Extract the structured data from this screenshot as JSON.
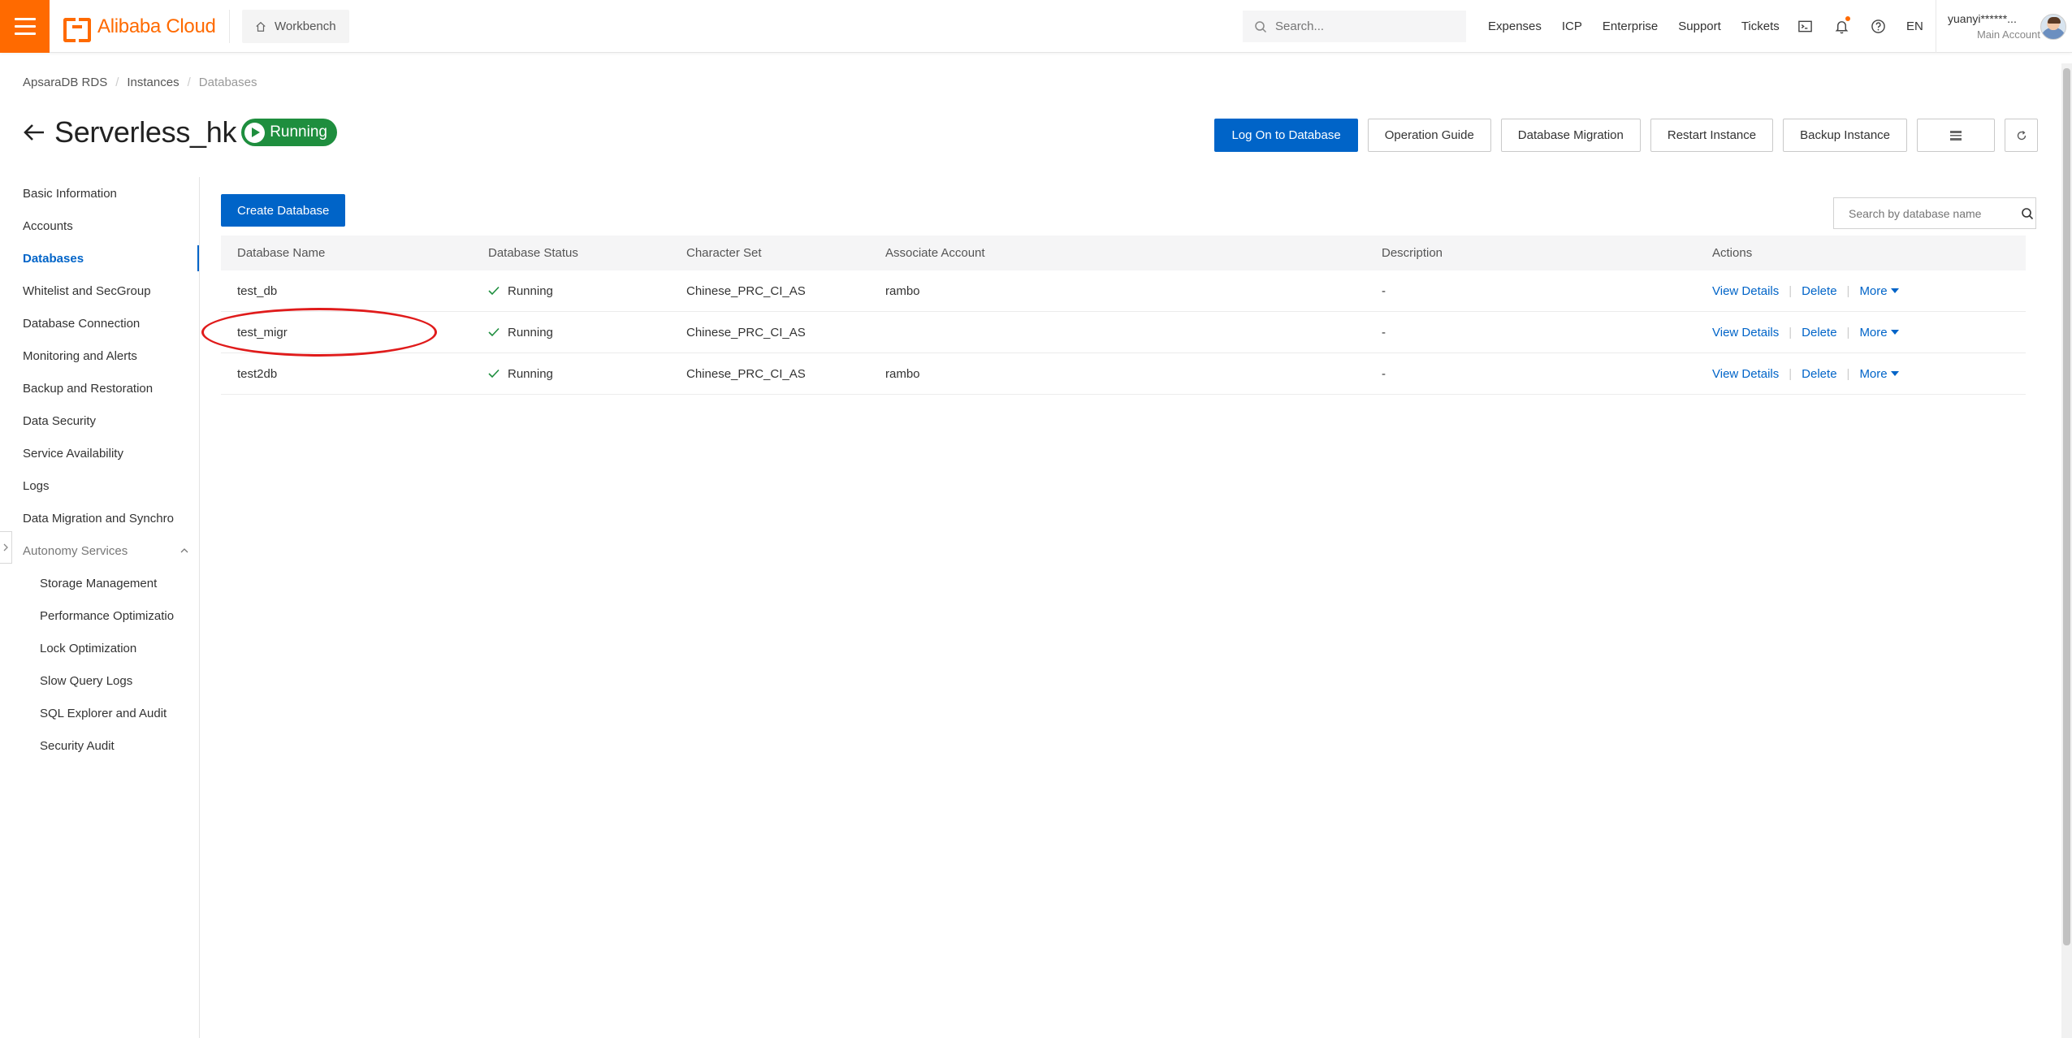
{
  "header": {
    "logo_text": "Alibaba Cloud",
    "workbench_label": "Workbench",
    "search_placeholder": "Search...",
    "links": [
      "Expenses",
      "ICP",
      "Enterprise",
      "Support",
      "Tickets"
    ],
    "language": "EN",
    "username": "yuanyi******...",
    "account_type": "Main Account",
    "brand_color": "#ff6a00"
  },
  "breadcrumb": [
    "ApsaraDB RDS",
    "Instances",
    "Databases"
  ],
  "instance": {
    "name": "Serverless_hk",
    "status": "Running"
  },
  "header_buttons": {
    "log_on": "Log On to Database",
    "operation_guide": "Operation Guide",
    "database_migration": "Database Migration",
    "restart_instance": "Restart Instance",
    "backup_instance": "Backup Instance"
  },
  "sidebar": {
    "items": [
      {
        "label": "Basic Information"
      },
      {
        "label": "Accounts"
      },
      {
        "label": "Databases",
        "active": true
      },
      {
        "label": "Whitelist and SecGroup"
      },
      {
        "label": "Database Connection"
      },
      {
        "label": "Monitoring and Alerts"
      },
      {
        "label": "Backup and Restoration"
      },
      {
        "label": "Data Security"
      },
      {
        "label": "Service Availability"
      },
      {
        "label": "Logs"
      },
      {
        "label": "Data Migration and Synchro"
      },
      {
        "label": "Autonomy Services"
      },
      {
        "label": "Storage Management"
      },
      {
        "label": "Performance Optimizatio"
      },
      {
        "label": "Lock Optimization"
      },
      {
        "label": "Slow Query Logs"
      },
      {
        "label": "SQL Explorer and Audit"
      },
      {
        "label": "Security Audit"
      }
    ]
  },
  "main": {
    "create_label": "Create Database",
    "search_placeholder": "Search by database name",
    "columns": [
      "Database Name",
      "Database Status",
      "Character Set",
      "Associate Account",
      "Description",
      "Actions"
    ],
    "rows": [
      {
        "name": "test_db",
        "status": "Running",
        "charset": "Chinese_PRC_CI_AS",
        "account": "rambo",
        "description": "-"
      },
      {
        "name": "test_migr",
        "status": "Running",
        "charset": "Chinese_PRC_CI_AS",
        "account": "",
        "description": "-"
      },
      {
        "name": "test2db",
        "status": "Running",
        "charset": "Chinese_PRC_CI_AS",
        "account": "rambo",
        "description": "-"
      }
    ],
    "actions": {
      "view": "View Details",
      "delete": "Delete",
      "more": "More"
    }
  }
}
